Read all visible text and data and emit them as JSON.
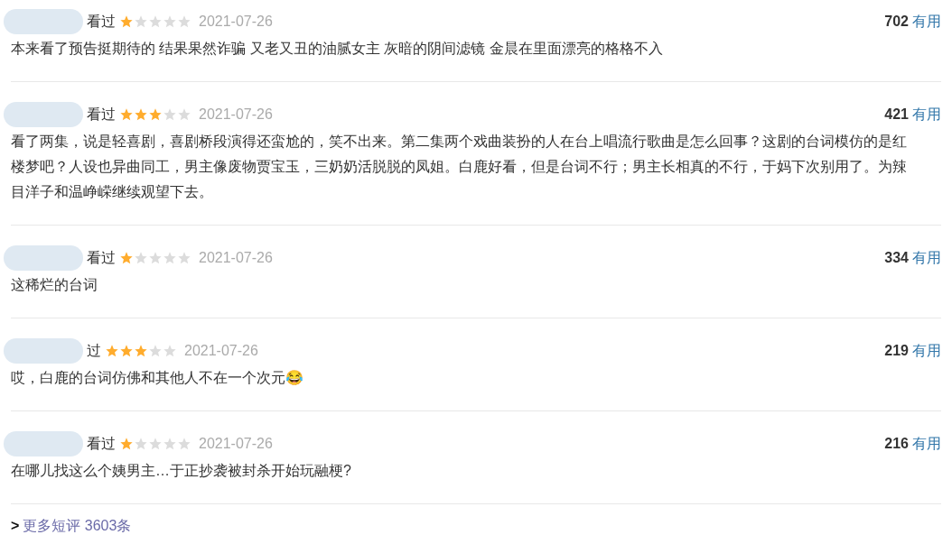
{
  "reviews": [
    {
      "status": "看过",
      "stars": 1,
      "date": "2021-07-26",
      "votes": "702",
      "useful": "有用",
      "text": "本来看了预告挺期待的 结果果然诈骗 又老又丑的油腻女主 灰暗的阴间滤镜 金晨在里面漂亮的格格不入"
    },
    {
      "status": "看过",
      "stars": 3,
      "date": "2021-07-26",
      "votes": "421",
      "useful": "有用",
      "text": "看了两集，说是轻喜剧，喜剧桥段演得还蛮尬的，笑不出来。第二集两个戏曲装扮的人在台上唱流行歌曲是怎么回事？这剧的台词模仿的是红楼梦吧？人设也异曲同工，男主像废物贾宝玉，三奶奶活脱脱的凤姐。白鹿好看，但是台词不行；男主长相真的不行，于妈下次别用了。为辣目洋子和温峥嵘继续观望下去。"
    },
    {
      "status": "看过",
      "stars": 1,
      "date": "2021-07-26",
      "votes": "334",
      "useful": "有用",
      "text": "这稀烂的台词"
    },
    {
      "status": "过",
      "stars": 3,
      "date": "2021-07-26",
      "votes": "219",
      "useful": "有用",
      "text": "哎，白鹿的台词仿佛和其他人不在一个次元😂"
    },
    {
      "status": "看过",
      "stars": 1,
      "date": "2021-07-26",
      "votes": "216",
      "useful": "有用",
      "text": "在哪儿找这么个姨男主…于正抄袭被封杀开始玩融梗?"
    }
  ],
  "more": {
    "arrow": ">",
    "label": "更多短评 3603条"
  }
}
